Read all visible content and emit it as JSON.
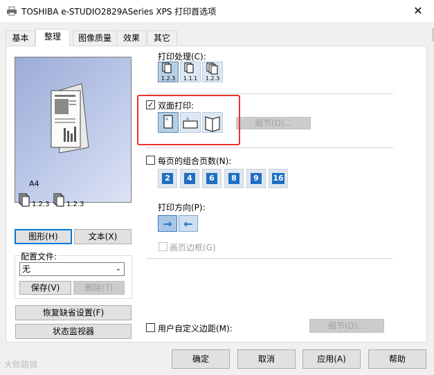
{
  "window": {
    "title": "TOSHIBA e-STUDIO2829ASeries XPS 打印首选项",
    "close_glyph": "✕"
  },
  "tabs": [
    {
      "label": "基本",
      "active": false
    },
    {
      "label": "整理",
      "active": true
    },
    {
      "label": "图像质量",
      "active": false
    },
    {
      "label": "效果",
      "active": false
    },
    {
      "label": "其它",
      "active": false
    }
  ],
  "preview": {
    "paper_size": "A4",
    "sort_labels": [
      "1.2.3",
      "1.2.3"
    ]
  },
  "view_buttons": {
    "graphic": "图形(H)",
    "text": "文本(X)"
  },
  "profile": {
    "group_label": "配置文件:",
    "selected": "无",
    "save": "保存(V)",
    "delete": "删除(T)"
  },
  "left_buttons": {
    "restore_defaults": "恢复缺省设置(F)",
    "status_monitor": "状态监视器"
  },
  "print_handling": {
    "label": "打印处理(C):",
    "options": [
      "1.2.3",
      "1.1.1",
      "1.2.3"
    ]
  },
  "duplex": {
    "label": "双面打印:",
    "checked": true,
    "details": "细节(D)...",
    "icon_letter": "A"
  },
  "pages_per_sheet": {
    "label": "每页的组合页数(N):",
    "checked": false,
    "options": [
      "2",
      "4",
      "6",
      "8",
      "9",
      "16"
    ]
  },
  "orientation": {
    "label": "打印方向(P):",
    "border_label": "画页边框(G)"
  },
  "custom_margin": {
    "label": "用户自定义边距(M):",
    "details": "细节(D)..."
  },
  "dialog_buttons": {
    "ok": "确定",
    "cancel": "取消",
    "apply": "应用(A)",
    "help": "帮助"
  },
  "watermark": "大败路锦",
  "colors": {
    "highlight_border": "#e8322e",
    "accent_blue": "#1f6fc4"
  }
}
